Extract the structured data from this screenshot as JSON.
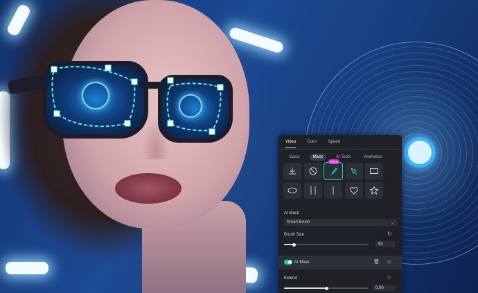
{
  "panel": {
    "tabs": [
      {
        "label": "Video",
        "active": true
      },
      {
        "label": "Color",
        "active": false
      },
      {
        "label": "Speed",
        "active": false
      }
    ],
    "subtabs": [
      {
        "label": "Basic",
        "active": false
      },
      {
        "label": "Mask",
        "active": true
      },
      {
        "label": "AI Tools",
        "active": false
      },
      {
        "label": "Animation",
        "active": false
      }
    ],
    "tools": [
      {
        "icon": "import-mask-icon"
      },
      {
        "icon": "no-mask-icon"
      },
      {
        "icon": "brush-mask-icon",
        "selected": true,
        "badge": "BETA"
      },
      {
        "icon": "pen-mask-icon"
      },
      {
        "icon": "rectangle-mask-icon"
      },
      {
        "icon": "ellipse-mask-icon"
      },
      {
        "icon": "double-line-mask-icon"
      },
      {
        "icon": "single-line-mask-icon"
      },
      {
        "icon": "heart-mask-icon"
      },
      {
        "icon": "star-mask-icon"
      }
    ],
    "ai_mask_label": "AI Mask",
    "ai_mask_mode": "Smart Brush",
    "brush_size_label": "Brush Size",
    "brush_size_value": "50",
    "brush_size_fraction": 0.12,
    "mask_row_label": "AI Mask",
    "mask_row_enabled": true,
    "extend_label": "Extend",
    "extend_value": "0.00",
    "extend_fraction": 0.5
  },
  "colors": {
    "accent": "#25d0c5",
    "badge": "#d63fd1",
    "panel_bg": "#1e2126"
  }
}
